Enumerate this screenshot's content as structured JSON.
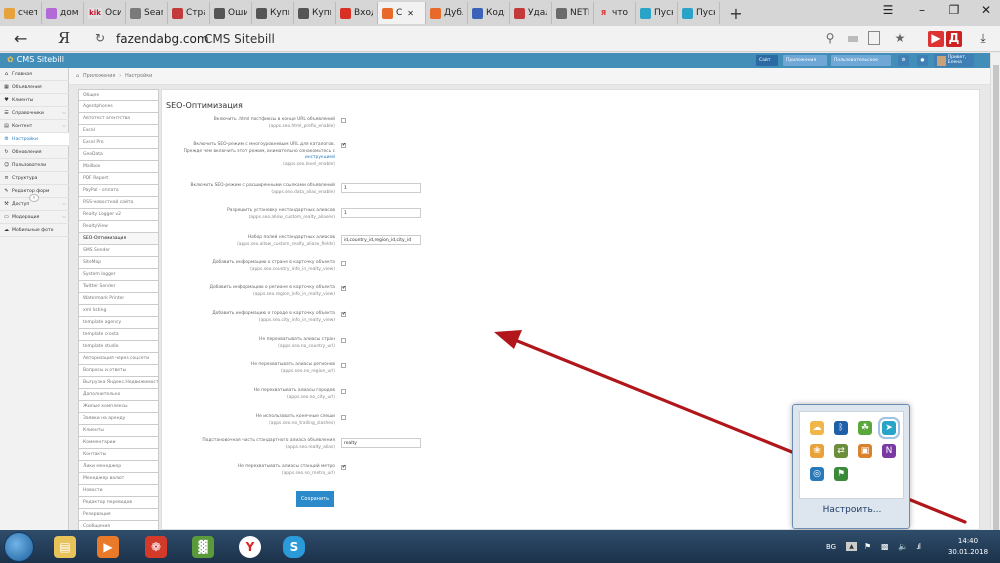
{
  "browser": {
    "tabs": [
      {
        "label": "счет",
        "icon": "mail-icon",
        "color": "#e6a23c"
      },
      {
        "label": "дом",
        "icon": "number-two-icon",
        "color": "#b36ad8"
      },
      {
        "label": "Оси",
        "icon": "kik-icon",
        "color": "#e0e0e0"
      },
      {
        "label": "Searc",
        "icon": "tablet-icon",
        "color": "#7a7a7a"
      },
      {
        "label": "Стра",
        "icon": "code-icon",
        "color": "#c23a3a"
      },
      {
        "label": "Оши",
        "icon": "house-icon",
        "color": "#555555"
      },
      {
        "label": "Купи",
        "icon": "house-icon",
        "color": "#555555"
      },
      {
        "label": "Купи",
        "icon": "house-icon",
        "color": "#555555"
      },
      {
        "label": "Вход",
        "icon": "gmail-icon",
        "color": "#d93025"
      },
      {
        "label": "С",
        "icon": "sitebill-icon",
        "color": "#e86a2a",
        "active": true
      },
      {
        "label": "Дубл",
        "icon": "sitebill-icon",
        "color": "#e86a2a"
      },
      {
        "label": "Коды",
        "icon": "triangle-icon",
        "color": "#3a62b8"
      },
      {
        "label": "Удал",
        "icon": "code-icon",
        "color": "#c23a3a"
      },
      {
        "label": "NETF",
        "icon": "diamond-icon",
        "color": "#6a6a6a"
      },
      {
        "label": "что т",
        "icon": "yandex-icon",
        "color": "#e53935"
      },
      {
        "label": "Пуск",
        "icon": "sailfish-icon",
        "color": "#2aa3c9"
      },
      {
        "label": "Пуск",
        "icon": "sailfish-icon",
        "color": "#2aa3c9"
      }
    ],
    "tab_plus": "+",
    "tab_kik_text": "kik",
    "url": "fazendabg.com",
    "page_title": "CMS Sitebill",
    "yandex_letter": "Я"
  },
  "cms": {
    "logo": "CMS Sitebill",
    "header_buttons": [
      {
        "label": "Сайт",
        "color": "#2b6aa3"
      },
      {
        "label": "Приложения",
        "color": "#6fa7d6"
      },
      {
        "label": "Пользовательское",
        "color": "#6fa7d6"
      },
      {
        "label": "Привет, Елена",
        "color": "#3f7fb5"
      }
    ],
    "sidebar": [
      {
        "label": "Главная",
        "icon": "home-icon",
        "chev": false
      },
      {
        "label": "Объявления",
        "icon": "grid-icon",
        "chev": false
      },
      {
        "label": "Клиенты",
        "icon": "heart-icon",
        "chev": false
      },
      {
        "label": "Справочники",
        "icon": "book-icon",
        "chev": true
      },
      {
        "label": "Контент",
        "icon": "file-icon",
        "chev": true
      },
      {
        "label": "Настройки",
        "icon": "gear-icon",
        "chev": false,
        "active": true
      },
      {
        "label": "Обновления",
        "icon": "refresh-icon",
        "chev": false
      },
      {
        "label": "Пользователи",
        "icon": "user-icon",
        "chev": false
      },
      {
        "label": "Структура",
        "icon": "list-icon",
        "chev": false
      },
      {
        "label": "Редактор форм",
        "icon": "edit-icon",
        "chev": false
      },
      {
        "label": "Доступ",
        "icon": "key-icon",
        "chev": true
      },
      {
        "label": "Модерация",
        "icon": "monitor-icon",
        "chev": true
      },
      {
        "label": "Мобильные фото",
        "icon": "cloud-icon",
        "chev": false
      }
    ],
    "breadcrumb": {
      "home": "Приложения",
      "sep": "›",
      "current": "Настройки"
    },
    "settings_list": [
      "Общее",
      "Agentphones",
      "Автотест агентства",
      "Excel",
      "Excel Pro",
      "GeoData",
      "Mailbox",
      "PDF Report",
      "PayPal - оплата",
      "RSS-новостной сайта",
      "Realty Logger v2",
      "RealtyView",
      "SEO-Оптимизация",
      "SMS Sender",
      "SiteMap",
      "System logger",
      "Twitter Sender",
      "Watermark Printer",
      "xml listing",
      "template agency",
      "template crosta",
      "template studio",
      "Авторизация через соцсети",
      "Вопросы и ответы",
      "Выгрузка Яндекс.Недвижимость",
      "Дополнительно",
      "Жилые комплексы",
      "Заявки на аренду",
      "Клиенты",
      "Комментарии",
      "Контакты",
      "Лики менеджер",
      "Менеджер валют",
      "Новости",
      "Редактор переводов",
      "Резервация",
      "Сообщения"
    ],
    "active_setting": "SEO-Оптимизация",
    "section_title": "SEO-Оптимизация",
    "fields": [
      {
        "lines": [
          "Включить .html постфиксы в конце URL объявлений"
        ],
        "key": "(apps.seo.html_prefix_enable)",
        "type": "checkbox",
        "checked": false
      },
      {
        "lines": [
          "Включить SEO-режим с многоуровневым URL для каталогов.",
          "Прежде чем включить этот режим, внимательно ознакомьтесь с",
          "инструкцией"
        ],
        "key": "(apps.seo.level_enable)",
        "type": "checkbox",
        "checked": true
      },
      {
        "lines": [
          "Включить SEO-режим с расширенными ссылками объявлений"
        ],
        "key": "(apps.seo.data_alias_enable)",
        "type": "text",
        "value": "1"
      },
      {
        "lines": [
          "Разрешить установку нестандартных алиасов"
        ],
        "key": "(apps.seo.allow_custom_realty_aliases)",
        "type": "text",
        "value": "1"
      },
      {
        "lines": [
          "Набор полей нестандартных алиасов"
        ],
        "key": "(apps.seo.allow_custom_realty_aliase_fields)",
        "type": "text",
        "value": "id,country_id,region_id,city_id"
      },
      {
        "lines": [
          "Добавить информацию о стране в карточку объекта"
        ],
        "key": "(apps.seo.country_info_in_realty_view)",
        "type": "checkbox",
        "checked": false
      },
      {
        "lines": [
          "Добавить информацию о регионе в карточку объекта"
        ],
        "key": "(apps.seo.region_info_in_realty_view)",
        "type": "checkbox",
        "checked": true
      },
      {
        "lines": [
          "Добавить информацию о городе в карточку объекта"
        ],
        "key": "(apps.seo.city_info_in_realty_view)",
        "type": "checkbox",
        "checked": true
      },
      {
        "lines": [
          "Не перехватывать алиасы стран"
        ],
        "key": "(apps.seo.no_country_url)",
        "type": "checkbox",
        "checked": false
      },
      {
        "lines": [
          "Не перехватывать алиасы регионов"
        ],
        "key": "(apps.seo.no_region_url)",
        "type": "checkbox",
        "checked": false
      },
      {
        "lines": [
          "Не перехватывать алиасы городов"
        ],
        "key": "(apps.seo.no_city_url)",
        "type": "checkbox",
        "checked": false
      },
      {
        "lines": [
          "Не использовать конечные слеши"
        ],
        "key": "(apps.seo.no_trailing_slashes)",
        "type": "checkbox",
        "checked": false
      },
      {
        "lines": [
          "Подстановочная часть стандартного алиаса объявления"
        ],
        "key": "(apps.seo.realty_alias)",
        "type": "text",
        "value": "realty"
      },
      {
        "lines": [
          "Не перехватывать алиасы станций метро"
        ],
        "key": "(apps.seo.no_metro_url)",
        "type": "checkbox",
        "checked": true
      }
    ],
    "save_label": "Сохранить"
  },
  "tray_popup": {
    "link": "Настроить...",
    "icons": [
      {
        "name": "cloud-storage-icon",
        "color": "#f0b64a"
      },
      {
        "name": "bluetooth-icon",
        "color": "#1f5ea8"
      },
      {
        "name": "green-leaf-icon",
        "color": "#5aa73b"
      },
      {
        "name": "sailfish-tray-icon",
        "color": "#2aa3c9"
      },
      {
        "name": "fan-icon",
        "color": "#e8a23a"
      },
      {
        "name": "arrows-icon",
        "color": "#6b8e3a"
      },
      {
        "name": "box-icon",
        "color": "#d9822b"
      },
      {
        "name": "onenote-icon",
        "color": "#7b3aa3"
      },
      {
        "name": "globe-icon",
        "color": "#2a7ab9"
      },
      {
        "name": "flag-icon",
        "color": "#3a8a3a"
      }
    ]
  },
  "taskbar": {
    "lang": "BG",
    "time": "14:40",
    "date": "30.01.2018",
    "apps": [
      {
        "name": "explorer-icon",
        "color": "#e7c35a"
      },
      {
        "name": "media-player-icon",
        "color": "#e87a2a"
      },
      {
        "name": "reel-icon",
        "color": "#d33a2a"
      },
      {
        "name": "chart-app-icon",
        "color": "#5a9a3a"
      },
      {
        "name": "yandex-browser-icon",
        "color": "#ffffff"
      },
      {
        "name": "skype-icon",
        "color": "#2a9ad9"
      }
    ],
    "skype_letter": "S",
    "yandex_letter": "Y"
  },
  "colors": {
    "accent": "#438eb9",
    "arrow": "#b0161a"
  }
}
